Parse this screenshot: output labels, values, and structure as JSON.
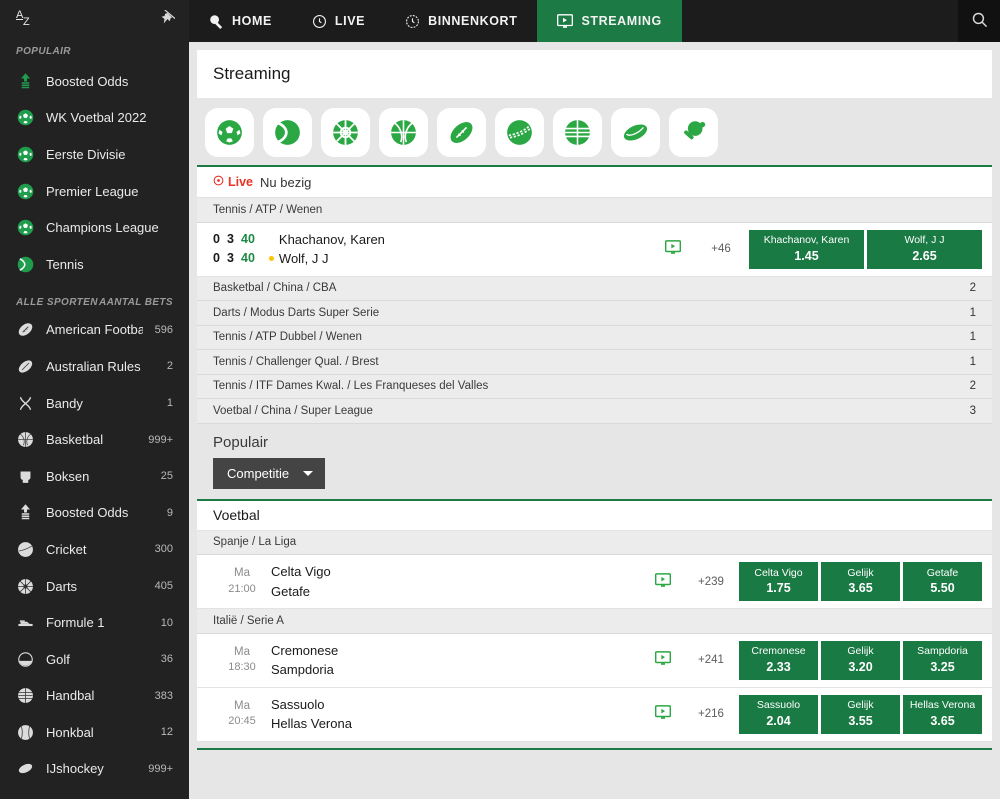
{
  "sidebar": {
    "sort_icon": "a-z-sort-icon",
    "pin_icon": "pin-off-icon",
    "popular_label": "POPULAIR",
    "popular_items": [
      {
        "label": "Boosted Odds",
        "icon": "boosted-odds-icon"
      },
      {
        "label": "WK Voetbal 2022",
        "icon": "football-icon"
      },
      {
        "label": "Eerste Divisie",
        "icon": "football-icon"
      },
      {
        "label": "Premier League",
        "icon": "football-icon"
      },
      {
        "label": "Champions League",
        "icon": "football-icon"
      },
      {
        "label": "Tennis",
        "icon": "tennis-icon"
      }
    ],
    "all_sports_label": "ALLE SPORTEN",
    "bets_count_label": "AANTAL BETS",
    "sports": [
      {
        "label": "American Football",
        "count": "596",
        "icon": "american-football-icon"
      },
      {
        "label": "Australian Rules",
        "count": "2",
        "icon": "australian-rules-icon"
      },
      {
        "label": "Bandy",
        "count": "1",
        "icon": "bandy-icon"
      },
      {
        "label": "Basketbal",
        "count": "999+",
        "icon": "basketball-icon"
      },
      {
        "label": "Boksen",
        "count": "25",
        "icon": "boxing-icon"
      },
      {
        "label": "Boosted Odds",
        "count": "9",
        "icon": "boosted-odds-icon"
      },
      {
        "label": "Cricket",
        "count": "300",
        "icon": "cricket-icon"
      },
      {
        "label": "Darts",
        "count": "405",
        "icon": "darts-icon"
      },
      {
        "label": "Formule 1",
        "count": "10",
        "icon": "formula1-icon"
      },
      {
        "label": "Golf",
        "count": "36",
        "icon": "golf-icon"
      },
      {
        "label": "Handbal",
        "count": "383",
        "icon": "handball-icon"
      },
      {
        "label": "Honkbal",
        "count": "12",
        "icon": "baseball-icon"
      },
      {
        "label": "IJshockey",
        "count": "999+",
        "icon": "ice-hockey-icon"
      }
    ]
  },
  "topnav": {
    "tabs": [
      {
        "label": "HOME",
        "icon": "home-icon",
        "active": false
      },
      {
        "label": "LIVE",
        "icon": "clock-icon",
        "active": false
      },
      {
        "label": "BINNENKORT",
        "icon": "upcoming-clock-icon",
        "active": false
      },
      {
        "label": "STREAMING",
        "icon": "stream-monitor-icon",
        "active": true
      }
    ],
    "search_icon": "search-icon"
  },
  "page": {
    "title": "Streaming"
  },
  "sports_strip": [
    {
      "icon": "football-icon",
      "name": "voetbal"
    },
    {
      "icon": "tennis-icon",
      "name": "tennis"
    },
    {
      "icon": "darts-icon",
      "name": "darts"
    },
    {
      "icon": "basketball-icon",
      "name": "basketbal"
    },
    {
      "icon": "american-football-icon",
      "name": "american-football"
    },
    {
      "icon": "cricket-icon",
      "name": "cricket"
    },
    {
      "icon": "volleyball-icon",
      "name": "volleybal"
    },
    {
      "icon": "ice-hockey-icon",
      "name": "ijshockey"
    },
    {
      "icon": "table-tennis-icon",
      "name": "tafeltennis"
    }
  ],
  "live": {
    "badge": "Live",
    "subtitle": "Nu bezig",
    "competition": "Tennis / ATP / Wenen",
    "match": {
      "scores_top": [
        "0",
        "3",
        "40"
      ],
      "scores_bottom": [
        "0",
        "3",
        "40"
      ],
      "team_home": "Khachanov, Karen",
      "team_away": "Wolf, J J",
      "serving": "away",
      "stream_icon": "stream-monitor-icon",
      "more_markets": "+46",
      "odds": [
        {
          "name": "Khachanov, Karen",
          "value": "1.45"
        },
        {
          "name": "Wolf, J J",
          "value": "2.65"
        }
      ]
    },
    "competitions": [
      {
        "label": "Basketbal / China / CBA",
        "count": "2"
      },
      {
        "label": "Darts / Modus Darts Super Serie",
        "count": "1"
      },
      {
        "label": "Tennis / ATP Dubbel / Wenen",
        "count": "1"
      },
      {
        "label": "Tennis / Challenger Qual. / Brest",
        "count": "1"
      },
      {
        "label": "Tennis / ITF Dames Kwal. / Les Franqueses del Valles",
        "count": "2"
      },
      {
        "label": "Voetbal / China / Super League",
        "count": "3"
      }
    ]
  },
  "popular": {
    "heading": "Populair",
    "filter_label": "Competitie",
    "sport_heading": "Voetbal",
    "leagues": [
      {
        "name": "Spanje / La Liga",
        "matches": [
          {
            "day": "Ma",
            "time": "21:00",
            "team_home": "Celta Vigo",
            "team_away": "Getafe",
            "stream_icon": "stream-monitor-icon",
            "more_markets": "+239",
            "odds": [
              {
                "name": "Celta Vigo",
                "value": "1.75"
              },
              {
                "name": "Gelijk",
                "value": "3.65"
              },
              {
                "name": "Getafe",
                "value": "5.50"
              }
            ]
          }
        ]
      },
      {
        "name": "Italië / Serie A",
        "matches": [
          {
            "day": "Ma",
            "time": "18:30",
            "team_home": "Cremonese",
            "team_away": "Sampdoria",
            "stream_icon": "stream-monitor-icon",
            "more_markets": "+241",
            "odds": [
              {
                "name": "Cremonese",
                "value": "2.33"
              },
              {
                "name": "Gelijk",
                "value": "3.20"
              },
              {
                "name": "Sampdoria",
                "value": "3.25"
              }
            ]
          },
          {
            "day": "Ma",
            "time": "20:45",
            "team_home": "Sassuolo",
            "team_away": "Hellas Verona",
            "stream_icon": "stream-monitor-icon",
            "more_markets": "+216",
            "odds": [
              {
                "name": "Sassuolo",
                "value": "2.04"
              },
              {
                "name": "Gelijk",
                "value": "3.55"
              },
              {
                "name": "Hellas Verona",
                "value": "3.65"
              }
            ]
          }
        ]
      }
    ]
  },
  "colors": {
    "brand_green": "#1c7a45",
    "odds_green": "#1a7a44",
    "icon_green": "#2ba844",
    "sidebar_bg": "#222222",
    "topnav_bg": "#1c1c1c",
    "live_red": "#e8342a",
    "serve_yellow": "#ffc400",
    "page_bg": "#e6e6e6"
  }
}
